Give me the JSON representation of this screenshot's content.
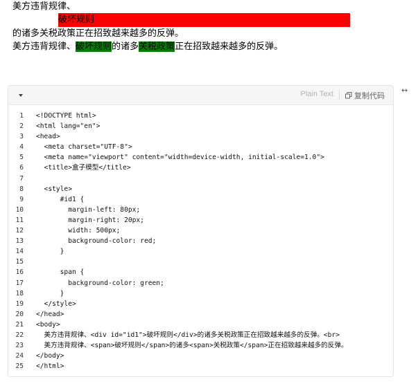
{
  "demo": {
    "line1": "美方违背规律、",
    "div_text": "破坏规则",
    "line3": "的诸多关税政策正在招致越来越多的反弹。",
    "line4_part1": "美方违背规律、",
    "line4_span1": "破坏规则",
    "line4_part2": "的诸多",
    "line4_span2": "关税政策",
    "line4_part3": "正在招致越来越多的反弹。",
    "colors": {
      "div_bg": "#ff0000",
      "span_bg": "#008000"
    }
  },
  "code_block": {
    "language": "Plain Text",
    "copy_label": "复制代码",
    "icons": {
      "collapse": "chevron-down-icon",
      "copy": "copy-icon",
      "expand": "expand-horizontal-icon"
    },
    "lines": [
      "<!DOCTYPE html>",
      "<html lang=\"en\">",
      "<head>",
      "  <meta charset=\"UTF-8\">",
      "  <meta name=\"viewport\" content=\"width=device-width, initial-scale=1.0\">",
      "  <title>盒子模型</title>",
      "",
      "  <style>",
      "      #id1 {",
      "        margin-left: 80px;",
      "        margin-right: 20px;",
      "        width: 500px;",
      "        background-color: red;",
      "      }",
      "",
      "      span {",
      "        background-color: green;",
      "      }",
      "  </style>",
      "</head>",
      "<body>",
      "  美方违背规律、<div id=\"id1\">破坏规则</div>的诸多关税政策正在招致越来越多的反弹。<br>",
      "  美方违背规律、<span>破坏规则</span>的诸多<span>关税政策</span>正在招致越来越多的反弹。",
      "</body>",
      "</html>"
    ]
  }
}
